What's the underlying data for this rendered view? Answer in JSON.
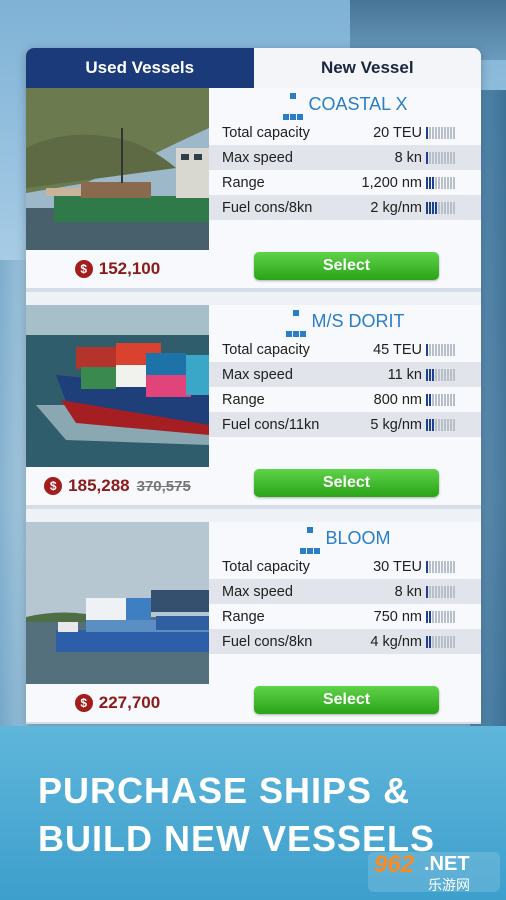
{
  "tabs": {
    "used": "Used Vessels",
    "new": "New Vessel"
  },
  "vessels": [
    {
      "name": "COASTAL X",
      "price": "152,100",
      "old_price": "",
      "stats": [
        {
          "label": "Total capacity",
          "value": "20 TEU",
          "level": 1
        },
        {
          "label": "Max speed",
          "value": "8 kn",
          "level": 1
        },
        {
          "label": "Range",
          "value": "1,200 nm",
          "level": 3
        },
        {
          "label": "Fuel cons/8kn",
          "value": "2 kg/nm",
          "level": 4
        }
      ],
      "select": "Select"
    },
    {
      "name": "M/S DORIT",
      "price": "185,288",
      "old_price": "370,575",
      "stats": [
        {
          "label": "Total capacity",
          "value": "45 TEU",
          "level": 1
        },
        {
          "label": "Max speed",
          "value": "11 kn",
          "level": 3
        },
        {
          "label": "Range",
          "value": "800 nm",
          "level": 2
        },
        {
          "label": "Fuel cons/11kn",
          "value": "5 kg/nm",
          "level": 3
        }
      ],
      "select": "Select"
    },
    {
      "name": "BLOOM",
      "price": "227,700",
      "old_price": "",
      "stats": [
        {
          "label": "Total capacity",
          "value": "30 TEU",
          "level": 1
        },
        {
          "label": "Max speed",
          "value": "8 kn",
          "level": 1
        },
        {
          "label": "Range",
          "value": "750 nm",
          "level": 2
        },
        {
          "label": "Fuel cons/8kn",
          "value": "4 kg/nm",
          "level": 2
        }
      ],
      "select": "Select"
    }
  ],
  "banner": {
    "line1": "PURCHASE SHIPS &",
    "line2": "BUILD NEW VESSELS"
  },
  "watermark": {
    "brand": "962",
    "suffix": ".NET",
    "sub": "乐游网"
  },
  "colors": {
    "accent": "#1b3a7a",
    "name": "#2a7ec7",
    "price": "#8b1a1a",
    "button": "#2aa317"
  }
}
